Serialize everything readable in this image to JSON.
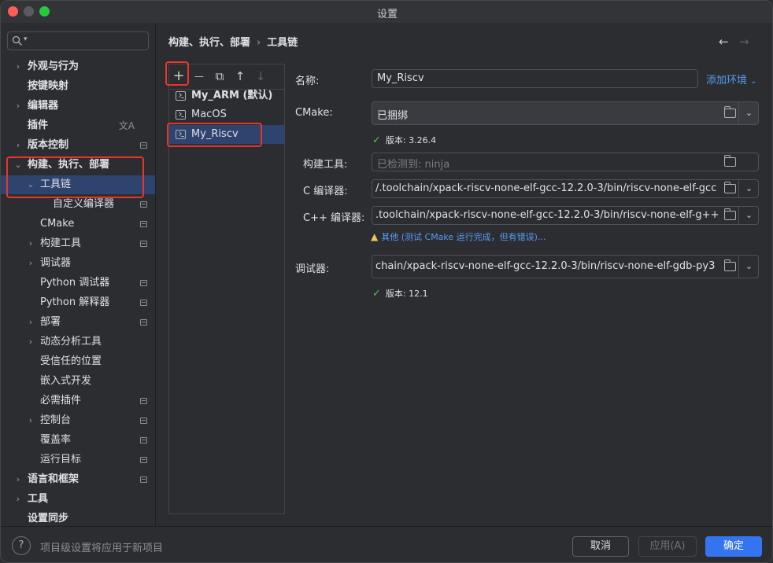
{
  "window": {
    "title": "设置"
  },
  "sidebar": {
    "search_placeholder": "",
    "items": [
      {
        "label": "外观与行为",
        "chevron": "›",
        "bold": true
      },
      {
        "label": "按键映射",
        "bold": true
      },
      {
        "label": "编辑器",
        "chevron": "›",
        "bold": true
      },
      {
        "label": "插件",
        "bold": true,
        "badge": "文A"
      },
      {
        "label": "版本控制",
        "chevron": "›",
        "bold": true
      },
      {
        "label": "构建、执行、部署",
        "chevron": "⌄",
        "bold": true
      },
      {
        "label": "工具链",
        "chevron": "⌄"
      },
      {
        "label": "自定义编译器"
      },
      {
        "label": "CMake"
      },
      {
        "label": "构建工具",
        "chevron": "›"
      },
      {
        "label": "调试器",
        "chevron": "›"
      },
      {
        "label": "Python 调试器"
      },
      {
        "label": "Python 解释器"
      },
      {
        "label": "部署",
        "chevron": "›"
      },
      {
        "label": "动态分析工具",
        "chevron": "›"
      },
      {
        "label": "受信任的位置"
      },
      {
        "label": "嵌入式开发"
      },
      {
        "label": "必需插件"
      },
      {
        "label": "控制台",
        "chevron": "›"
      },
      {
        "label": "覆盖率"
      },
      {
        "label": "运行目标"
      },
      {
        "label": "语言和框架",
        "chevron": "›",
        "bold": true
      },
      {
        "label": "工具",
        "chevron": "›",
        "bold": true
      },
      {
        "label": "设置同步",
        "bold": true
      }
    ]
  },
  "breadcrumb": {
    "parent": "构建、执行、部署",
    "separator": "›",
    "current": "工具链"
  },
  "nav": {
    "back": "←",
    "forward": "→"
  },
  "toolbar": {
    "add": "+",
    "remove": "—",
    "copy": "⧉",
    "up": "↑",
    "down": "↓"
  },
  "toolchains": [
    {
      "name": "My_ARM (默认)",
      "bold": true
    },
    {
      "name": "MacOS"
    },
    {
      "name": "My_Riscv",
      "selected": true
    }
  ],
  "form": {
    "name_label": "名称:",
    "name_value": "My_Riscv",
    "add_env": "添加环境",
    "cmake_label": "CMake:",
    "cmake_value": "已捆绑",
    "cmake_version": "版本: 3.26.4",
    "build_tool_label": "构建工具:",
    "build_tool_placeholder": "已检测到: ninja",
    "c_compiler_label": "C 编译器:",
    "c_compiler_value": "/.toolchain/xpack-riscv-none-elf-gcc-12.2.0-3/bin/riscv-none-elf-gcc",
    "cpp_compiler_label": "C++ 编译器:",
    "cpp_compiler_value": ".toolchain/xpack-riscv-none-elf-gcc-12.2.0-3/bin/riscv-none-elf-g++",
    "warning": "其他 (测试 CMake 运行完成，但有错误)...",
    "debugger_label": "调试器:",
    "debugger_value": "chain/xpack-riscv-none-elf-gcc-12.2.0-3/bin/riscv-none-elf-gdb-py3",
    "debugger_version": "版本: 12.1"
  },
  "footer": {
    "help": "?",
    "note": "项目级设置将应用于新项目",
    "cancel": "取消",
    "apply": "应用(A)",
    "ok": "确定"
  },
  "colors": {
    "accent": "#3574f0",
    "selection": "#2e436e",
    "annotation": "#e8352c",
    "link": "#589df6"
  }
}
